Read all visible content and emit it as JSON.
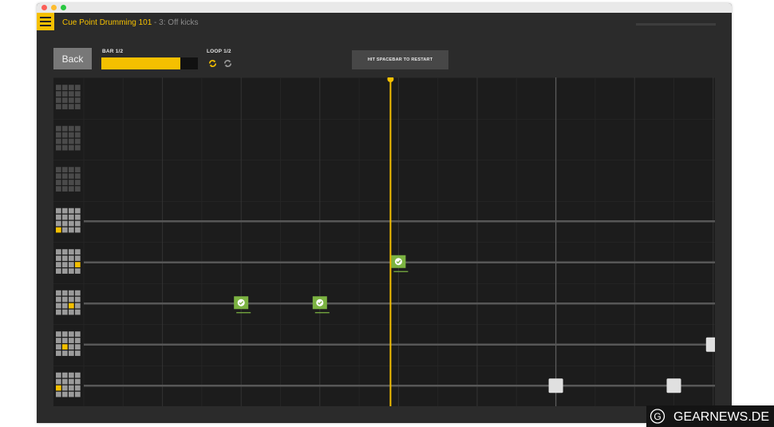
{
  "header": {
    "lesson_title": "Cue Point Drumming 101",
    "separator": " - ",
    "step_title": "3: Off kicks"
  },
  "controls": {
    "back_label": "Back",
    "bar_label": "BAR 1/2",
    "bar_progress": 0.82,
    "loop_label": "LOOP 1/2",
    "loops_total": 2,
    "loops_completed": 1,
    "restart_label": "HIT SPACEBAR TO RESTART"
  },
  "timeline": {
    "lanes": 8,
    "beat_lines": 8,
    "playhead_position": 0.5,
    "lanes_with_lines": [
      4,
      5,
      6,
      7,
      8
    ],
    "pad_highlights": [
      null,
      null,
      null,
      {
        "row": 3,
        "col": 0
      },
      {
        "row": 2,
        "col": 3
      },
      {
        "row": 2,
        "col": 2
      },
      {
        "row": 2,
        "col": 1
      },
      {
        "row": 2,
        "col": 0
      }
    ],
    "notes": [
      {
        "lane": 6,
        "beat": 2.0,
        "state": "hit"
      },
      {
        "lane": 6,
        "beat": 3.0,
        "state": "hit"
      },
      {
        "lane": 5,
        "beat": 4.0,
        "state": "hit"
      },
      {
        "lane": 8,
        "beat": 6.0,
        "state": "pending"
      },
      {
        "lane": 8,
        "beat": 7.5,
        "state": "pending"
      },
      {
        "lane": 7,
        "beat": 8.0,
        "state": "pending"
      }
    ]
  },
  "watermark": {
    "logo_letter": "G",
    "text": "GEARNEWS.DE"
  },
  "colors": {
    "accent": "#f5c000",
    "hit": "#7cb342",
    "pending": "#e0e0e0",
    "pad": "#9b9b9b",
    "pad_inactive": "#4a4a4a"
  }
}
